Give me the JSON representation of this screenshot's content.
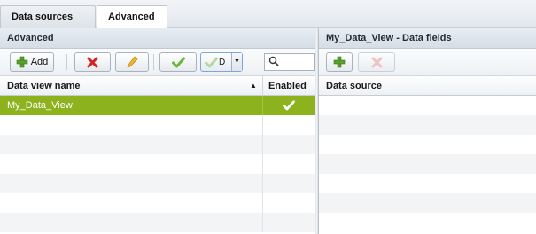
{
  "tabs": [
    {
      "label": "Data sources"
    },
    {
      "label": "Advanced"
    }
  ],
  "left_panel": {
    "title": "Advanced",
    "toolbar": {
      "add_label": "Add",
      "split_button_partial": "D",
      "search_placeholder": ""
    },
    "columns": {
      "name": "Data view name",
      "enabled": "Enabled"
    },
    "rows": [
      {
        "name": "My_Data_View",
        "enabled": true
      }
    ]
  },
  "right_panel": {
    "title": "My_Data_View - Data fields",
    "columns": {
      "source": "Data source"
    }
  },
  "colors": {
    "selection": "#8cb21e",
    "add_green": "#5aa02c",
    "delete_red": "#d42020",
    "check_green": "#6ab83a"
  }
}
